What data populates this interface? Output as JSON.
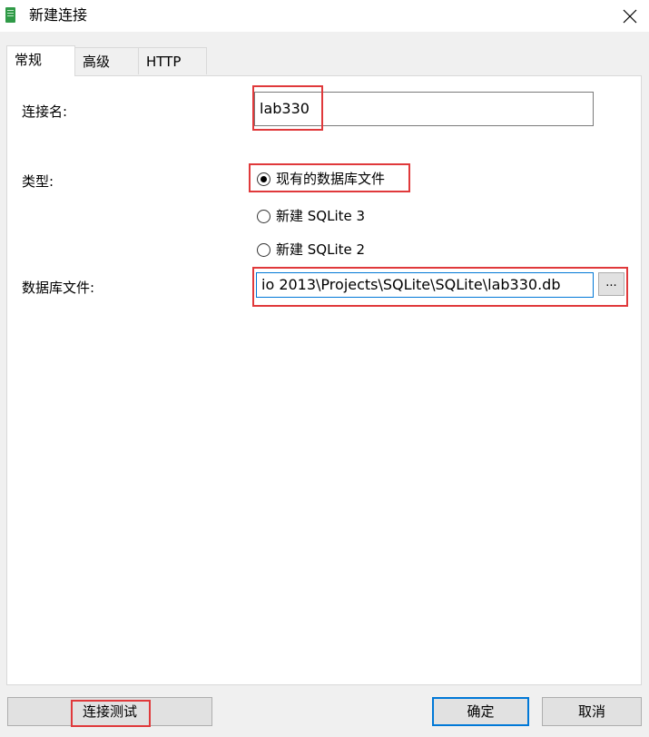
{
  "window": {
    "title": "新建连接",
    "app_icon": "database-app-icon",
    "close_icon": "close-x-icon"
  },
  "tabs": [
    {
      "label": "常规",
      "active": true
    },
    {
      "label": "高级",
      "active": false
    },
    {
      "label": "HTTP",
      "active": false
    }
  ],
  "form": {
    "connection_name_label": "连接名:",
    "connection_name_value": "lab330",
    "type_label": "类型:",
    "type_options": [
      {
        "label": "现有的数据库文件",
        "checked": true
      },
      {
        "label": "新建 SQLite 3",
        "checked": false
      },
      {
        "label": "新建 SQLite 2",
        "checked": false
      }
    ],
    "db_file_label": "数据库文件:",
    "db_file_value": "io 2013\\Projects\\SQLite\\SQLite\\lab330.db",
    "browse_label": "..."
  },
  "footer": {
    "test_connection_label": "连接测试",
    "ok_label": "确定",
    "cancel_label": "取消"
  },
  "colors": {
    "highlight": "#e0393b",
    "focus_border": "#0078d7",
    "app_icon": "#2f9a47"
  }
}
